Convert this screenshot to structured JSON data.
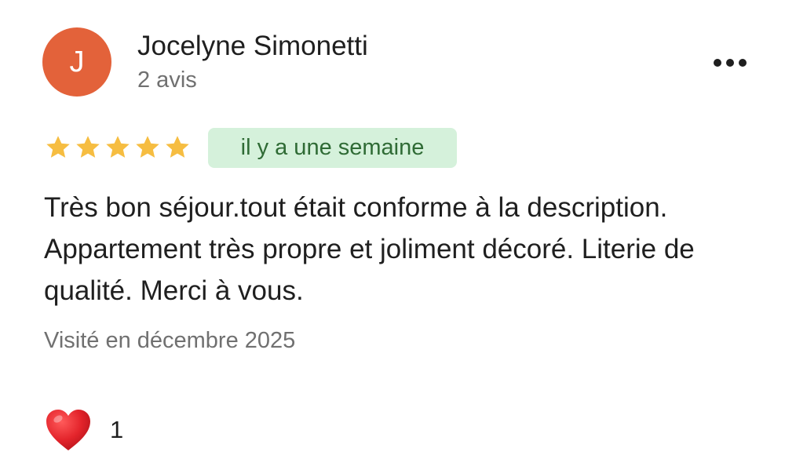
{
  "review": {
    "author": {
      "initial": "J",
      "name": "Jocelyne Simonetti",
      "review_count": "2 avis",
      "avatar_color": "#e3623a"
    },
    "rating": 5,
    "rating_max": 5,
    "star_color": "#f6bd41",
    "time_ago": "il y a une semaine",
    "text": "Très bon séjour.tout était conforme à la description. Appartement très propre et joliment décoré. Literie de qualité. Merci à vous.",
    "visit": "Visité en décembre 2025",
    "reaction": {
      "icon": "heart-icon",
      "count": "1"
    },
    "more_icon": "more-options-icon"
  }
}
